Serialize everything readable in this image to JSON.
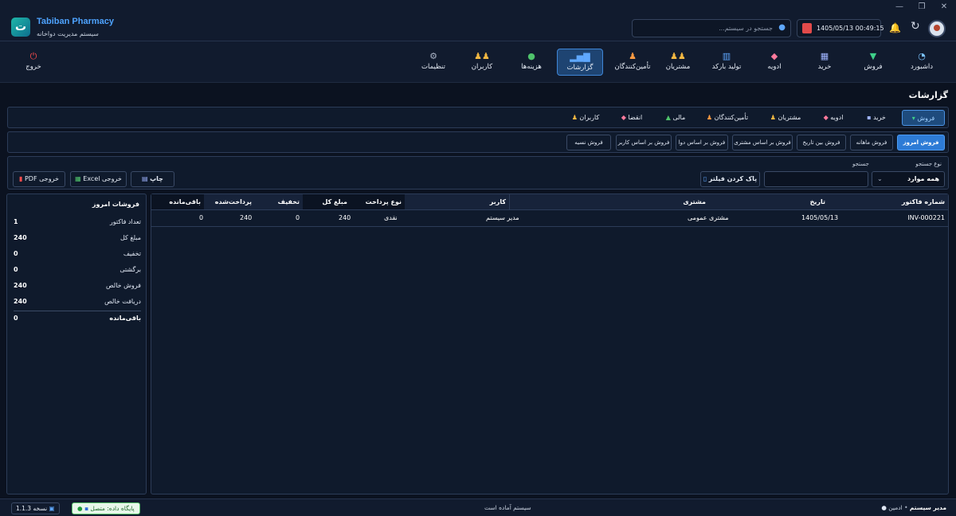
{
  "app": {
    "title": "Tabiban Pharmacy",
    "subtitle": "سیستم مدیریت دواخانه"
  },
  "window_controls": {
    "minimize": "—",
    "maximize": "❐",
    "close": "✕"
  },
  "header": {
    "search_placeholder": "جستجو در سیستم...",
    "date": "1405/05/13",
    "time": "00:49:15",
    "datetime_text": "1405/05/13  00:49:15"
  },
  "nav": {
    "items": [
      {
        "label": "داشبورد",
        "icon": "dashboard-icon",
        "glyph": "◔",
        "color": "#7cc4ff"
      },
      {
        "label": "فروش",
        "icon": "cart-icon",
        "glyph": "🛒",
        "color": "#3fd18a"
      },
      {
        "label": "خرید",
        "icon": "purchase-icon",
        "glyph": "▦",
        "color": "#9fb4ff"
      },
      {
        "label": "ادویه",
        "icon": "pill-icon",
        "glyph": "💊",
        "color": "#ff7a9c"
      },
      {
        "label": "تولید بارکد",
        "icon": "barcode-icon",
        "glyph": "▥",
        "color": "#5fa8ff"
      },
      {
        "label": "مشتریان",
        "icon": "customers-icon",
        "glyph": "👥",
        "color": "#f5b942"
      },
      {
        "label": "تأمین‌کنندگان",
        "icon": "suppliers-icon",
        "glyph": "🧑",
        "color": "#ff9b42"
      },
      {
        "label": "گزارشات",
        "icon": "reports-icon",
        "glyph": "📊",
        "color": "#5fa8ff"
      },
      {
        "label": "هزینه‌ها",
        "icon": "expenses-icon",
        "glyph": "💰",
        "color": "#4fc36b"
      },
      {
        "label": "کاربران",
        "icon": "users-icon",
        "glyph": "👥",
        "color": "#f5b942"
      },
      {
        "label": "تنظیمات",
        "icon": "settings-icon",
        "glyph": "⚙",
        "color": "#aab4c6"
      }
    ],
    "active": "گزارشات",
    "logout": "خروج"
  },
  "page": {
    "title": "گزارشات"
  },
  "report_tabs": [
    "فروش",
    "خرید",
    "ادویه",
    "مشتریان",
    "تأمین‌کنندگان",
    "مالی",
    "انقضا",
    "کاربران"
  ],
  "sub_tabs": [
    "فروش امروز",
    "فروش ماهانه",
    "فروش بین تاریخ",
    "فروش بر اساس مشتری",
    "فروش بر اساس دوا",
    "فروش بر اساس کاربر",
    "فروش نسیه"
  ],
  "filters": {
    "search_type_label": "نوع جستجو",
    "search_type_value": "همه موارد",
    "search_label": "جستجو",
    "search_value": "",
    "clear_button": "پاک کردن فیلتر"
  },
  "actions": {
    "print": "چاپ",
    "excel": "Excel خروجی",
    "pdf": "PDF خروجی"
  },
  "summary": {
    "title": "فروشات امروز",
    "rows": [
      {
        "label": "تعداد فاکتور",
        "value": "1"
      },
      {
        "label": "مبلغ کل",
        "value": "240"
      },
      {
        "label": "تخفیف",
        "value": "0"
      },
      {
        "label": "برگشتی",
        "value": "0"
      },
      {
        "label": "فروش خالص",
        "value": "240"
      },
      {
        "label": "دریافت خالص",
        "value": "240"
      }
    ],
    "remaining": {
      "label": "باقی‌مانده",
      "value": "0"
    }
  },
  "table": {
    "columns": [
      "شماره فاکتور",
      "تاریخ",
      "مشتری",
      "کاربر",
      "نوع پرداخت",
      "مبلغ کل",
      "تخفیف",
      "پرداخت‌شده",
      "باقی‌مانده"
    ],
    "rows": [
      [
        "INV-000221",
        "1405/05/13",
        "مشتری عمومی",
        "مدیر سیستم",
        "نقدی",
        "240",
        "0",
        "240",
        "0"
      ]
    ]
  },
  "status": {
    "user": "مدیر سیستم",
    "role": "ادمین",
    "message": "سیستم آماده است",
    "db": "پایگاه داده: متصل",
    "version": "نسخه 1.1.3"
  }
}
